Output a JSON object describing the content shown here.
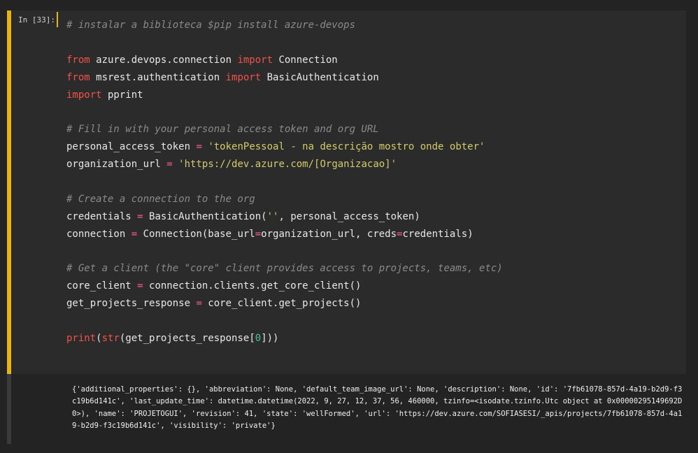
{
  "cell": {
    "prompt": "In [33]:",
    "code_lines": [
      [
        {
          "t": "cm",
          "v": "# instalar a biblioteca $pip install azure-devops"
        }
      ],
      [],
      [
        {
          "t": "kw",
          "v": "from"
        },
        {
          "t": "tx",
          "v": " azure.devops.connection "
        },
        {
          "t": "kw",
          "v": "import"
        },
        {
          "t": "tx",
          "v": " Connection"
        }
      ],
      [
        {
          "t": "kw",
          "v": "from"
        },
        {
          "t": "tx",
          "v": " msrest.authentication "
        },
        {
          "t": "kw",
          "v": "import"
        },
        {
          "t": "tx",
          "v": " BasicAuthentication"
        }
      ],
      [
        {
          "t": "kw",
          "v": "import"
        },
        {
          "t": "tx",
          "v": " pprint"
        }
      ],
      [],
      [
        {
          "t": "cm",
          "v": "# Fill in with your personal access token and org URL"
        }
      ],
      [
        {
          "t": "tx",
          "v": "personal_access_token "
        },
        {
          "t": "op",
          "v": "="
        },
        {
          "t": "tx",
          "v": " "
        },
        {
          "t": "st",
          "v": "'tokenPessoal - na descrição mostro onde obter'"
        }
      ],
      [
        {
          "t": "tx",
          "v": "organization_url "
        },
        {
          "t": "op",
          "v": "="
        },
        {
          "t": "tx",
          "v": " "
        },
        {
          "t": "st",
          "v": "'https://dev.azure.com/[Organizacao]'"
        }
      ],
      [],
      [
        {
          "t": "cm",
          "v": "# Create a connection to the org"
        }
      ],
      [
        {
          "t": "tx",
          "v": "credentials "
        },
        {
          "t": "op",
          "v": "="
        },
        {
          "t": "tx",
          "v": " BasicAuthentication("
        },
        {
          "t": "st",
          "v": "''"
        },
        {
          "t": "tx",
          "v": ", personal_access_token)"
        }
      ],
      [
        {
          "t": "tx",
          "v": "connection "
        },
        {
          "t": "op",
          "v": "="
        },
        {
          "t": "tx",
          "v": " Connection(base_url"
        },
        {
          "t": "op",
          "v": "="
        },
        {
          "t": "tx",
          "v": "organization_url, creds"
        },
        {
          "t": "op",
          "v": "="
        },
        {
          "t": "tx",
          "v": "credentials)"
        }
      ],
      [],
      [
        {
          "t": "cm",
          "v": "# Get a client (the \"core\" client provides access to projects, teams, etc)"
        }
      ],
      [
        {
          "t": "tx",
          "v": "core_client "
        },
        {
          "t": "op",
          "v": "="
        },
        {
          "t": "tx",
          "v": " connection.clients.get_core_client()"
        }
      ],
      [
        {
          "t": "tx",
          "v": "get_projects_response "
        },
        {
          "t": "op",
          "v": "="
        },
        {
          "t": "tx",
          "v": " core_client.get_projects()"
        }
      ],
      [],
      [
        {
          "t": "bi",
          "v": "print"
        },
        {
          "t": "tx",
          "v": "("
        },
        {
          "t": "bi",
          "v": "str"
        },
        {
          "t": "tx",
          "v": "(get_projects_response["
        },
        {
          "t": "nm",
          "v": "0"
        },
        {
          "t": "tx",
          "v": "]))"
        }
      ]
    ]
  },
  "output": {
    "lines": [
      "{'additional_properties': {}, 'abbreviation': None, 'default_team_image_url': None, 'description': None, 'id': '7fb61078-857d-4a19-b2d9-f3",
      "c19b6d141c', 'last_update_time': datetime.datetime(2022, 9, 27, 12, 37, 56, 460000, tzinfo=<isodate.tzinfo.Utc object at 0x00000295149692D",
      "0>), 'name': 'PROJETOGUI', 'revision': 41, 'state': 'wellFormed', 'url': 'https://dev.azure.com/SOFIASESI/_apis/projects/7fb61078-857d-4a1",
      "9-b2d9-f3c19b6d141c', 'visibility': 'private'}"
    ]
  },
  "colors": {
    "background": "#232323",
    "cell_background": "#2b2b2b",
    "active_cell_bar": "#e7b416",
    "comment": "#8a8a8a",
    "keyword": "#f2524a",
    "string": "#d2cc6a",
    "operator": "#ff5f8a",
    "number": "#4fbfa3",
    "text": "#e8e8e8"
  }
}
